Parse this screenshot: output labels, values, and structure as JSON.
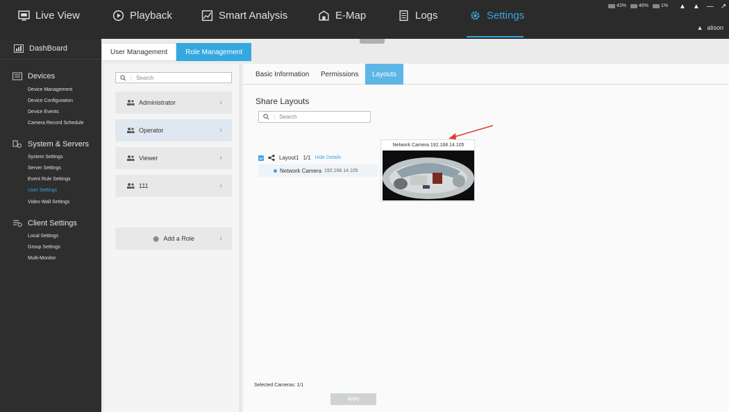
{
  "nav": {
    "items": [
      {
        "label": "Live View",
        "icon": "monitor-icon"
      },
      {
        "label": "Playback",
        "icon": "play-circle-icon"
      },
      {
        "label": "Smart Analysis",
        "icon": "chart-icon"
      },
      {
        "label": "E-Map",
        "icon": "map-icon"
      },
      {
        "label": "Logs",
        "icon": "logs-icon"
      },
      {
        "label": "Settings",
        "icon": "gear-icon"
      }
    ],
    "active": "Settings"
  },
  "system": {
    "cpu": "43%",
    "memory": "46%",
    "network": "1%",
    "user": "alison"
  },
  "sidebar": {
    "dashboard": "DashBoard",
    "groups": [
      {
        "label": "Devices",
        "items": [
          "Device Management",
          "Device Configuration",
          "Device Events",
          "Camera Record Schedule"
        ]
      },
      {
        "label": "System & Servers",
        "items": [
          "System Settings",
          "Server Settings",
          "Event Rule Settings",
          "User Settings",
          "Video Wall Settings"
        ]
      },
      {
        "label": "Client Settings",
        "items": [
          "Local Settings",
          "Group Settings",
          "Multi-Monitor"
        ]
      }
    ],
    "active_item": "User Settings"
  },
  "tabs": {
    "user_management": "User Management",
    "role_management": "Role Management"
  },
  "roles": {
    "search_placeholder": "Search",
    "items": [
      "Administrator",
      "Operator",
      "Viewer",
      "111"
    ],
    "selected": "Operator",
    "add_label": "Add a Role"
  },
  "settings": {
    "subtabs": [
      "Basic Information",
      "Permissions",
      "Layouts"
    ],
    "active_subtab": "Layouts",
    "section_title": "Share Layouts",
    "search_placeholder": "Search",
    "layout": {
      "name": "Layout1",
      "count": "1/1",
      "toggle": "Hide Details"
    },
    "camera": {
      "name": "Network Camera",
      "ip": "192.168.14.105"
    },
    "preview_title": "Network Camera  192.168.14.105",
    "selected_label": "Selected Cameras: 1/1",
    "apply_label": "Apply"
  }
}
